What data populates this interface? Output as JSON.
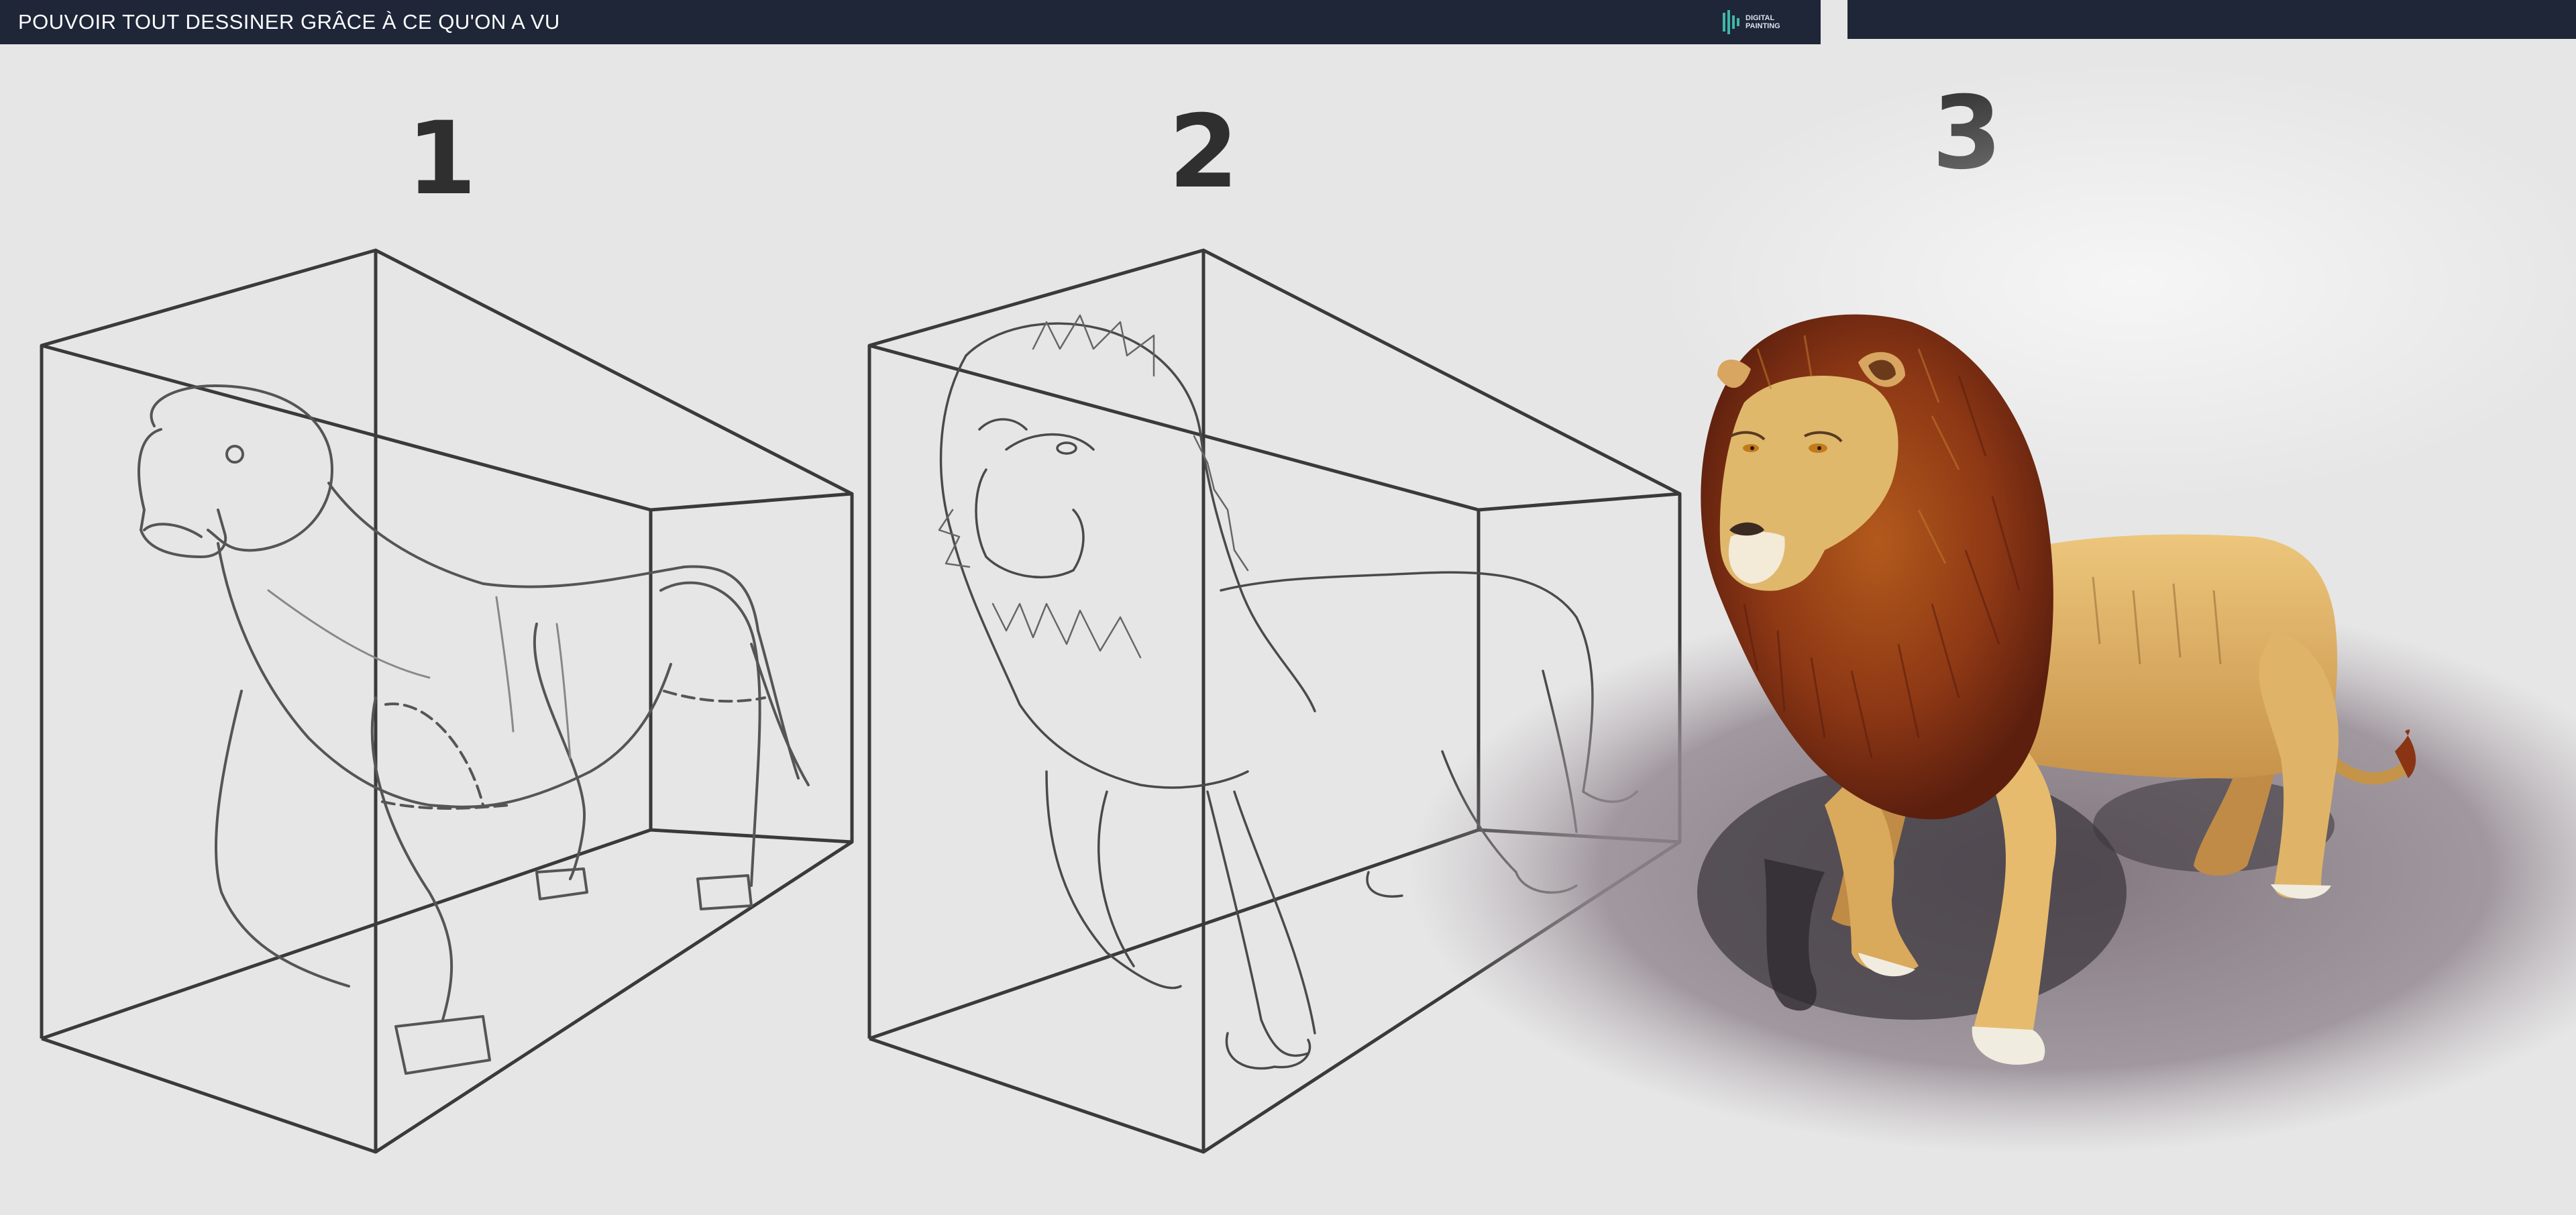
{
  "header": {
    "title": "POUVOIR TOUT DESSINER GRÂCE À CE QU'ON A VU",
    "logo_line1": "DIGITAL",
    "logo_line2": "PAINTING"
  },
  "steps": [
    {
      "label": "1"
    },
    {
      "label": "2"
    },
    {
      "label": "3"
    }
  ],
  "colors": {
    "header_bg": "#1f2638",
    "canvas_bg": "#e6e6e6",
    "sketch_line": "#3a3a3a",
    "mane": "#8a3414",
    "body_fur": "#e2b567",
    "ground_shadow": "#8f838c"
  }
}
